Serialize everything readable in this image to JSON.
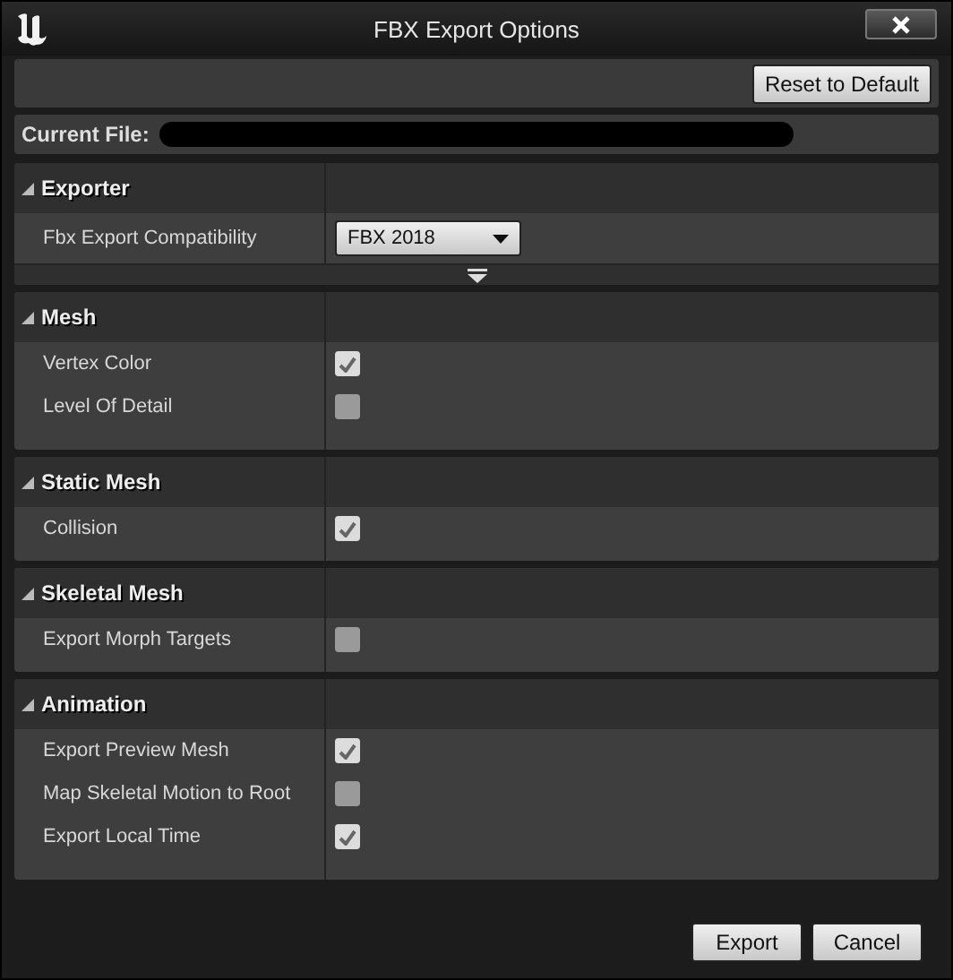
{
  "window": {
    "title": "FBX Export Options"
  },
  "toolbar": {
    "reset_button": "Reset to Default"
  },
  "current_file": {
    "label": "Current File:"
  },
  "sections": [
    {
      "title": "Exporter",
      "expanded": true,
      "has_advanced": true,
      "rows": [
        {
          "kind": "dropdown",
          "label": "Fbx Export Compatibility",
          "value": "FBX 2018"
        }
      ]
    },
    {
      "title": "Mesh",
      "expanded": true,
      "rows": [
        {
          "kind": "checkbox",
          "label": "Vertex Color",
          "checked": true
        },
        {
          "kind": "checkbox",
          "label": "Level Of Detail",
          "checked": false
        }
      ]
    },
    {
      "title": "Static Mesh",
      "expanded": true,
      "rows": [
        {
          "kind": "checkbox",
          "label": "Collision",
          "checked": true
        }
      ]
    },
    {
      "title": "Skeletal Mesh",
      "expanded": true,
      "rows": [
        {
          "kind": "checkbox",
          "label": "Export Morph Targets",
          "checked": false
        }
      ]
    },
    {
      "title": "Animation",
      "expanded": true,
      "rows": [
        {
          "kind": "checkbox",
          "label": "Export Preview Mesh",
          "checked": true
        },
        {
          "kind": "checkbox",
          "label": "Map Skeletal Motion to Root",
          "checked": false
        },
        {
          "kind": "checkbox",
          "label": "Export Local Time",
          "checked": true
        }
      ]
    }
  ],
  "buttons": [
    "Export",
    "Cancel"
  ]
}
